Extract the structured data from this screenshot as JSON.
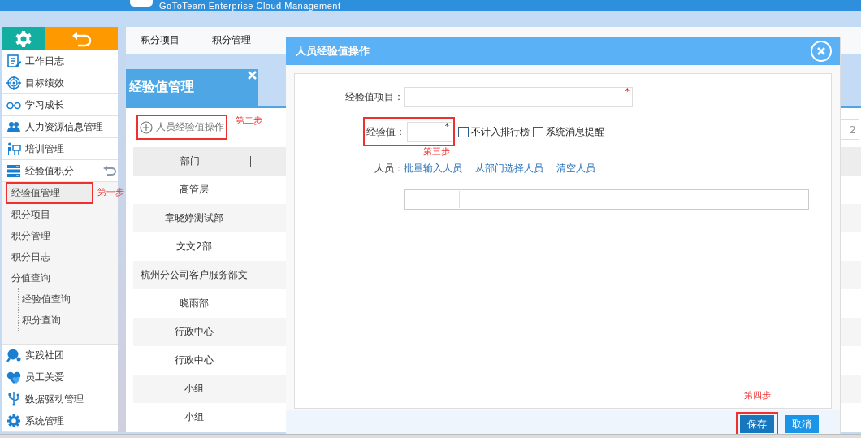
{
  "header": {
    "title": "GoToTeam Enterprise Cloud Management"
  },
  "sidebar": {
    "items": [
      {
        "label": "工作日志"
      },
      {
        "label": "目标绩效"
      },
      {
        "label": "学习成长"
      },
      {
        "label": "人力资源信息管理"
      },
      {
        "label": "培训管理"
      },
      {
        "label": "经验值积分",
        "expanded": true,
        "children": [
          {
            "label": "经验值管理",
            "selected": true,
            "annotation": "第一步"
          },
          {
            "label": "积分项目",
            "selected": false
          },
          {
            "label": "积分管理",
            "selected": false
          },
          {
            "label": "积分日志",
            "selected": false
          },
          {
            "label": "分值查询",
            "selected": false,
            "children": [
              {
                "label": "经验值查询",
                "selected": false
              },
              {
                "label": "积分查询",
                "selected": false
              }
            ]
          }
        ]
      },
      {
        "label": "实践社团"
      },
      {
        "label": "员工关爱"
      },
      {
        "label": "数据驱动管理"
      },
      {
        "label": "系统管理"
      }
    ]
  },
  "nav_tabs": [
    {
      "label": "积分项目"
    },
    {
      "label": "积分管理"
    }
  ],
  "panel": {
    "title": "经验值管理",
    "add_button": {
      "label": "人员经验值操作",
      "annotation": "第二步"
    },
    "pager_value": "2",
    "table": {
      "columns": [
        "部门"
      ],
      "rows": [
        [
          "高管层"
        ],
        [
          "章晓婷测试部"
        ],
        [
          "文文2部"
        ],
        [
          "杭州分公司客户服务部文"
        ],
        [
          "晓雨部"
        ],
        [
          "行政中心"
        ],
        [
          "行政中心"
        ],
        [
          "小组"
        ],
        [
          "小组"
        ]
      ]
    }
  },
  "dialog": {
    "title": "人员经验值操作",
    "item_field": {
      "label": "经验值项目：",
      "required": true,
      "required_mark": "*"
    },
    "value_field": {
      "label": "经验值：",
      "required": true,
      "required_mark": "*",
      "annotation": "第三步"
    },
    "checkboxes": [
      {
        "label": "不计入排行榜",
        "checked": false
      },
      {
        "label": "系统消息提醒",
        "checked": false
      }
    ],
    "people": {
      "label": "人员：",
      "links": [
        "批量输入人员",
        "从部门选择人员",
        "清空人员"
      ]
    },
    "buttons": [
      {
        "label": "保存",
        "kind": "primary",
        "annotation": "第四步"
      },
      {
        "label": "取消",
        "kind": "secondary"
      }
    ]
  }
}
